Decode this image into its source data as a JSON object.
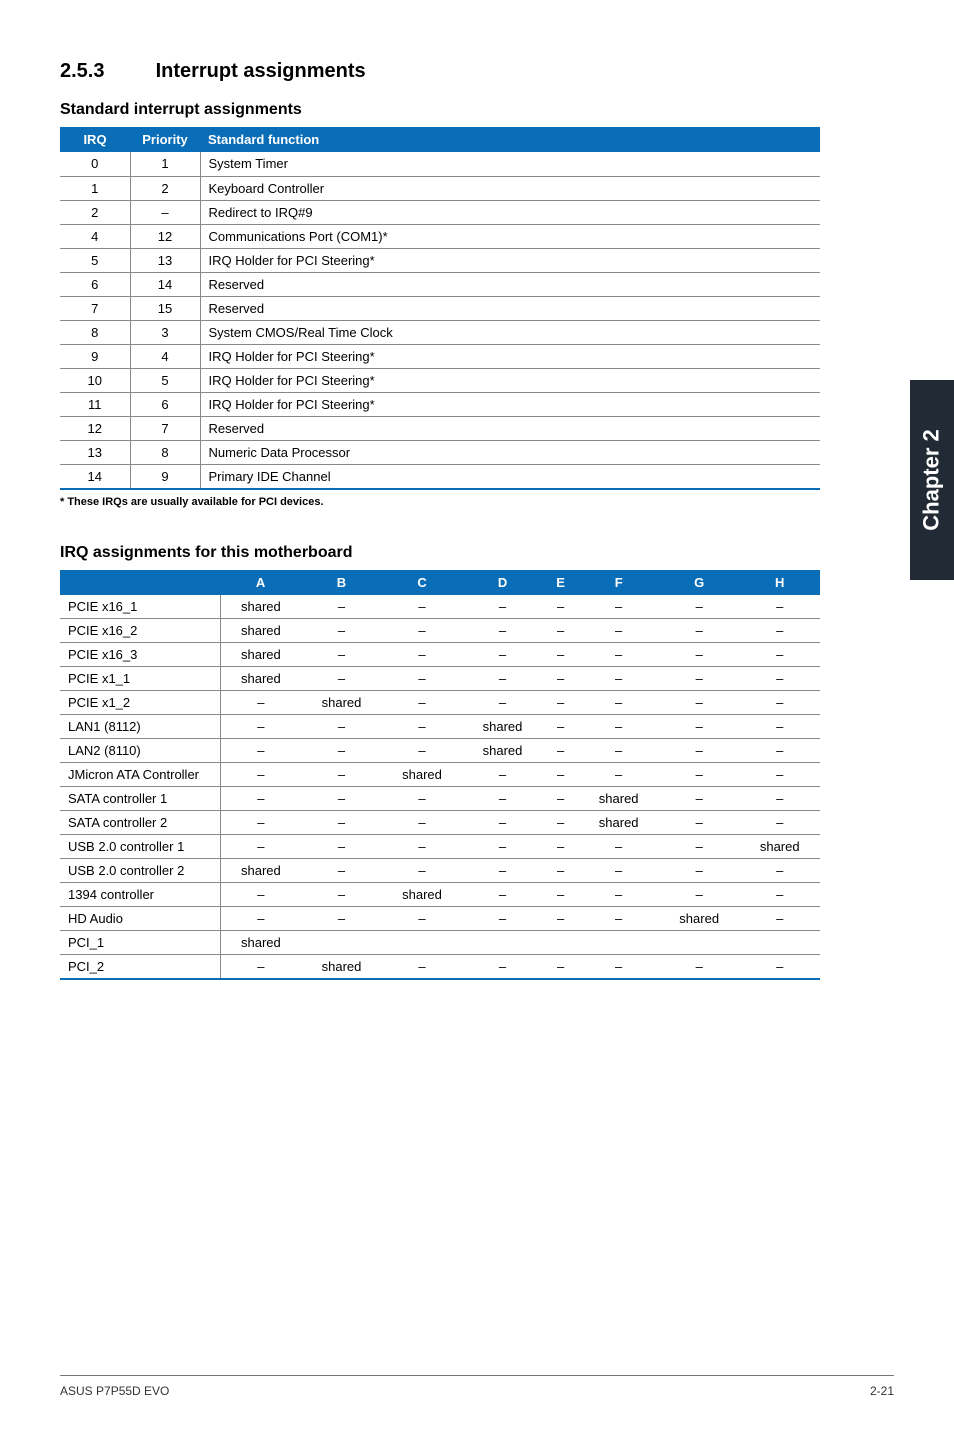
{
  "section": {
    "number": "2.5.3",
    "title": "Interrupt assignments"
  },
  "std_head": "Standard interrupt assignments",
  "std_cols": [
    "IRQ",
    "Priority",
    "Standard function"
  ],
  "std_rows": [
    {
      "irq": "0",
      "pri": "1",
      "fn": "System Timer"
    },
    {
      "irq": "1",
      "pri": "2",
      "fn": "Keyboard Controller"
    },
    {
      "irq": "2",
      "pri": "–",
      "fn": "Redirect to IRQ#9"
    },
    {
      "irq": "4",
      "pri": "12",
      "fn": "Communications Port (COM1)*"
    },
    {
      "irq": "5",
      "pri": "13",
      "fn": "IRQ Holder for PCI Steering*"
    },
    {
      "irq": "6",
      "pri": "14",
      "fn": "Reserved"
    },
    {
      "irq": "7",
      "pri": "15",
      "fn": "Reserved"
    },
    {
      "irq": "8",
      "pri": "3",
      "fn": "System CMOS/Real Time Clock"
    },
    {
      "irq": "9",
      "pri": "4",
      "fn": "IRQ Holder for PCI Steering*"
    },
    {
      "irq": "10",
      "pri": "5",
      "fn": "IRQ Holder for PCI Steering*"
    },
    {
      "irq": "11",
      "pri": "6",
      "fn": "IRQ Holder for PCI Steering*"
    },
    {
      "irq": "12",
      "pri": "7",
      "fn": "Reserved"
    },
    {
      "irq": "13",
      "pri": "8",
      "fn": "Numeric Data Processor"
    },
    {
      "irq": "14",
      "pri": "9",
      "fn": "Primary IDE Channel"
    }
  ],
  "footnote": "* These IRQs are usually available for PCI devices.",
  "irq_head": "IRQ assignments for this motherboard",
  "irq_cols": [
    "",
    "A",
    "B",
    "C",
    "D",
    "E",
    "F",
    "G",
    "H"
  ],
  "irq_rows": [
    {
      "label": "PCIE x16_1",
      "cells": [
        "shared",
        "–",
        "–",
        "–",
        "–",
        "–",
        "–",
        "–"
      ]
    },
    {
      "label": "PCIE x16_2",
      "cells": [
        "shared",
        "–",
        "–",
        "–",
        "–",
        "–",
        "–",
        "–"
      ]
    },
    {
      "label": "PCIE x16_3",
      "cells": [
        "shared",
        "–",
        "–",
        "–",
        "–",
        "–",
        "–",
        "–"
      ]
    },
    {
      "label": "PCIE x1_1",
      "cells": [
        "shared",
        "–",
        "–",
        "–",
        "–",
        "–",
        "–",
        "–"
      ]
    },
    {
      "label": "PCIE x1_2",
      "cells": [
        "–",
        "shared",
        "–",
        "–",
        "–",
        "–",
        "–",
        "–"
      ]
    },
    {
      "label": "LAN1 (8112)",
      "cells": [
        "–",
        "–",
        "–",
        "shared",
        "–",
        "–",
        "–",
        "–"
      ]
    },
    {
      "label": "LAN2 (8110)",
      "cells": [
        "–",
        "–",
        "–",
        "shared",
        "–",
        "–",
        "–",
        "–"
      ]
    },
    {
      "label": "JMicron ATA Controller",
      "cells": [
        "–",
        "–",
        "shared",
        "–",
        "–",
        "–",
        "–",
        "–"
      ]
    },
    {
      "label": "SATA controller 1",
      "cells": [
        "–",
        "–",
        "–",
        "–",
        "–",
        "shared",
        "–",
        "–"
      ]
    },
    {
      "label": "SATA controller 2",
      "cells": [
        "–",
        "–",
        "–",
        "–",
        "–",
        "shared",
        "–",
        "–"
      ]
    },
    {
      "label": "USB 2.0 controller 1",
      "cells": [
        "–",
        "–",
        "–",
        "–",
        "–",
        "–",
        "–",
        "shared"
      ]
    },
    {
      "label": "USB 2.0 controller 2",
      "cells": [
        "shared",
        "–",
        "–",
        "–",
        "–",
        "–",
        "–",
        "–"
      ]
    },
    {
      "label": "1394 controller",
      "cells": [
        "–",
        "–",
        "shared",
        "–",
        "–",
        "–",
        "–",
        "–"
      ]
    },
    {
      "label": "HD Audio",
      "cells": [
        "–",
        "–",
        "–",
        "–",
        "–",
        "–",
        "shared",
        "–"
      ]
    },
    {
      "label": "PCI_1",
      "cells": [
        "shared",
        "",
        "",
        "",
        "",
        "",
        "",
        ""
      ]
    },
    {
      "label": "PCI_2",
      "cells": [
        "–",
        "shared",
        "–",
        "–",
        "–",
        "–",
        "–",
        "–"
      ]
    }
  ],
  "side_tab": "Chapter 2",
  "footer": {
    "left": "ASUS P7P55D EVO",
    "right": "2-21"
  }
}
